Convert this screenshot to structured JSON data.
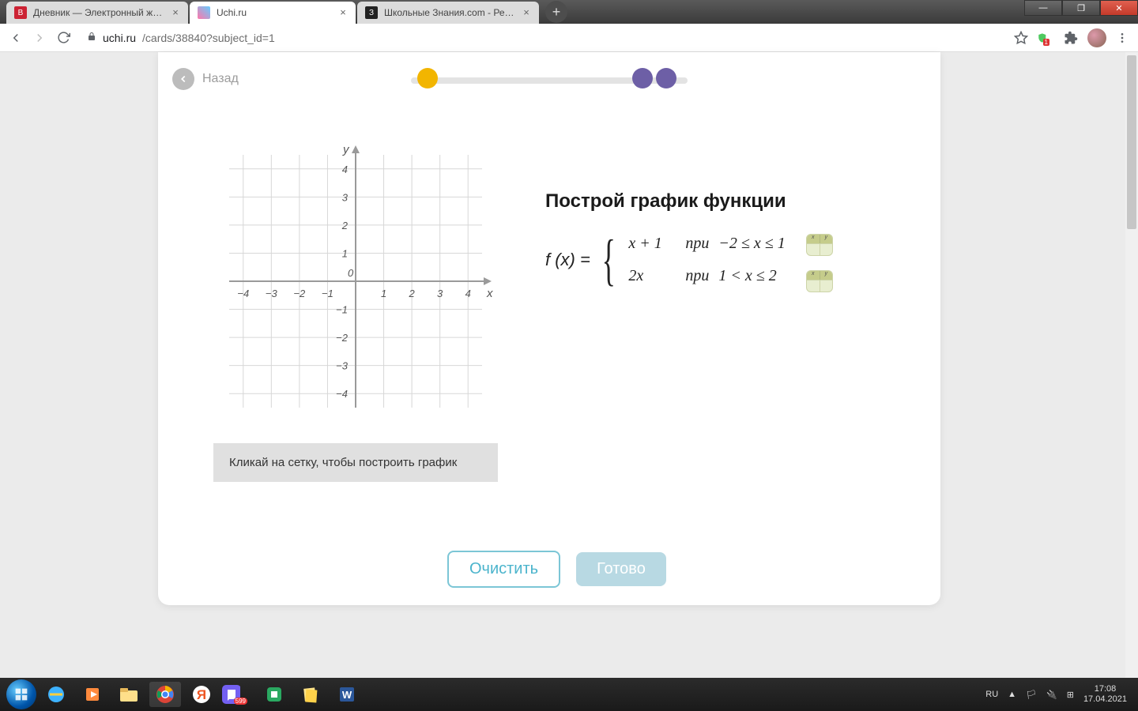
{
  "browser": {
    "tabs": [
      {
        "title": "Дневник — Электронный журн",
        "favicon_bg": "#c23",
        "favicon_txt": "В"
      },
      {
        "title": "Uchi.ru",
        "favicon_bg": "#f7d24a",
        "favicon_txt": ""
      },
      {
        "title": "Школьные Знания.com - Реша",
        "favicon_bg": "#222",
        "favicon_txt": "З"
      }
    ],
    "active_tab": 1,
    "url_host": "uchi.ru",
    "url_path": "/cards/38840?subject_id=1"
  },
  "page": {
    "back_label": "Назад",
    "hint": "Кликай на сетку, чтобы построить график",
    "title": "Построй график функции",
    "fx_label": "f (x) =",
    "cases": [
      {
        "expr": "x + 1",
        "pri": "при",
        "range": "−2 ≤ x ≤ 1"
      },
      {
        "expr": "2x",
        "pri": "при",
        "range": "1 < x ≤ 2"
      }
    ],
    "clear_btn": "Очистить",
    "done_btn": "Готово",
    "axis": {
      "x_label": "x",
      "y_label": "y",
      "ticks": [
        -4,
        -3,
        -2,
        -1,
        0,
        1,
        2,
        3,
        4
      ]
    }
  },
  "chart_data": {
    "type": "line",
    "title": "",
    "xlabel": "x",
    "ylabel": "y",
    "xlim": [
      -4.5,
      4.5
    ],
    "ylim": [
      -4.5,
      4.5
    ],
    "x_ticks": [
      -4,
      -3,
      -2,
      -1,
      0,
      1,
      2,
      3,
      4
    ],
    "y_ticks": [
      -4,
      -3,
      -2,
      -1,
      0,
      1,
      2,
      3,
      4
    ],
    "series": []
  },
  "system": {
    "lang": "RU",
    "time": "17:08",
    "date": "17.04.2021"
  }
}
